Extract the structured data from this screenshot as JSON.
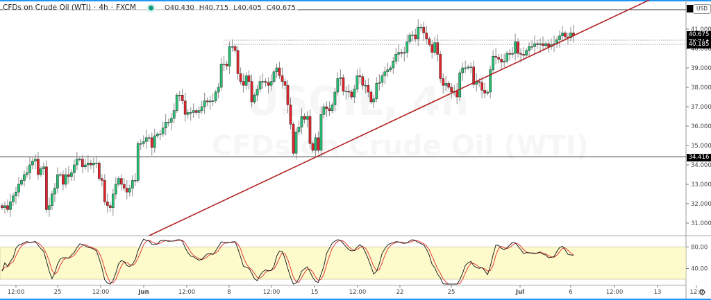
{
  "header": {
    "symbol": "CFDs on Crude Oil (WTI)",
    "interval": "4h",
    "exchange": "FXCM",
    "separator": "·",
    "open": "O40.430",
    "high": "H40.715",
    "low": "L40.405",
    "close": "C40.675"
  },
  "watermark": {
    "line1": "USOIL, 4h",
    "line2": "CFDs on Crude Oil (WTI)"
  },
  "currency_button": "USD",
  "settings_icon": "gear-icon",
  "colors": {
    "up": "#26c073",
    "down": "#e3242b",
    "trendline": "#b22222",
    "stoch_k": "#222222",
    "stoch_d": "#e53935",
    "stoch_band": "#fdfbcc",
    "accent": "#2196f3"
  },
  "price_tags": {
    "last": "40.675",
    "mid": "40.471",
    "lower": "40.185",
    "support": "34.416"
  },
  "chart_data": [
    {
      "type": "candlestick",
      "ylim": [
        30.6,
        42.0
      ],
      "grid": false,
      "y_ticks": [
        "41.000",
        "40.000",
        "39.000",
        "38.000",
        "37.000",
        "36.000",
        "35.000",
        "34.000",
        "33.000",
        "32.000",
        "31.000"
      ],
      "x_ticks": [
        "12:00",
        "25",
        "12:00",
        "Jun",
        "12:00",
        "8",
        "12:00",
        "15",
        "12:00",
        "22",
        "25",
        "Jul",
        "6",
        "12:00",
        "13",
        "12:0"
      ],
      "close": [
        31.8,
        31.9,
        31.7,
        32.1,
        32.4,
        32.6,
        33.0,
        33.2,
        33.5,
        33.6,
        34.0,
        34.2,
        34.3,
        33.5,
        33.8,
        33.9,
        31.7,
        31.9,
        32.5,
        32.8,
        33.5,
        33.5,
        33.0,
        33.5,
        33.4,
        33.6,
        34.0,
        34.3,
        34.3,
        33.9,
        34.0,
        34.1,
        34.0,
        34.1,
        34.1,
        33.3,
        33.2,
        32.1,
        31.9,
        31.8,
        32.5,
        33.0,
        33.3,
        33.0,
        32.8,
        32.6,
        32.8,
        33.2,
        33.2,
        35.1,
        35.1,
        35.2,
        35.4,
        35.4,
        34.9,
        35.5,
        35.6,
        35.6,
        35.9,
        36.2,
        36.2,
        36.4,
        36.8,
        37.6,
        37.6,
        37.3,
        36.6,
        36.7,
        36.7,
        36.8,
        36.7,
        36.8,
        37.0,
        37.3,
        37.25,
        37.3,
        37.3,
        37.75,
        38.0,
        39.2,
        39.2,
        39.1,
        40.1,
        40.1,
        39.9,
        38.7,
        38.3,
        38.1,
        38.6,
        38.3,
        37.25,
        37.6,
        37.9,
        38.3,
        38.3,
        38.25,
        38.1,
        38.3,
        38.8,
        39.0,
        38.6,
        38.3,
        38.1,
        37.1,
        36.1,
        34.6,
        35.7,
        35.95,
        36.5,
        36.35,
        36.5,
        35.1,
        34.75,
        35.4,
        34.75,
        36.6,
        37.0,
        36.9,
        36.8,
        37.1,
        37.75,
        38.45,
        38.5,
        37.8,
        37.8,
        37.75,
        37.5,
        37.9,
        38.6,
        38.55,
        38.1,
        38.1,
        37.75,
        37.25,
        37.4,
        38.2,
        38.25,
        38.6,
        38.8,
        38.9,
        39.0,
        39.35,
        39.7,
        39.8,
        39.75,
        39.8,
        40.35,
        40.7,
        40.7,
        40.5,
        41.1,
        41.1,
        40.8,
        40.5,
        40.2,
        39.8,
        40.3,
        39.7,
        38.45,
        38.1,
        38.2,
        38.0,
        37.75,
        37.8,
        37.5,
        38.75,
        39.0,
        39.0,
        39.05,
        39.05,
        38.15,
        38.3,
        38.25,
        37.85,
        37.7,
        37.75,
        38.9,
        39.6,
        39.55,
        39.45,
        39.3,
        39.35,
        39.75,
        39.7,
        39.75,
        40.35,
        39.75,
        39.7,
        39.65,
        39.9,
        40.1,
        40.1,
        40.25,
        40.2,
        40.25,
        40.15,
        40.25,
        40.1,
        40.2,
        40.25,
        40.45,
        40.65,
        40.8,
        40.6,
        40.55,
        40.8,
        40.675
      ],
      "horizontal_lines": [
        42.0,
        34.416
      ],
      "dotted_lines": [
        40.471,
        40.185
      ],
      "trendline": "rising support line drawn from late May lows through early July"
    },
    {
      "type": "line",
      "indicator": "stochastic",
      "series": [
        "%K",
        "%D"
      ],
      "ylim": [
        0,
        100
      ],
      "y_ticks": [
        "80.00",
        "40.00"
      ],
      "band": [
        20,
        80
      ]
    }
  ]
}
